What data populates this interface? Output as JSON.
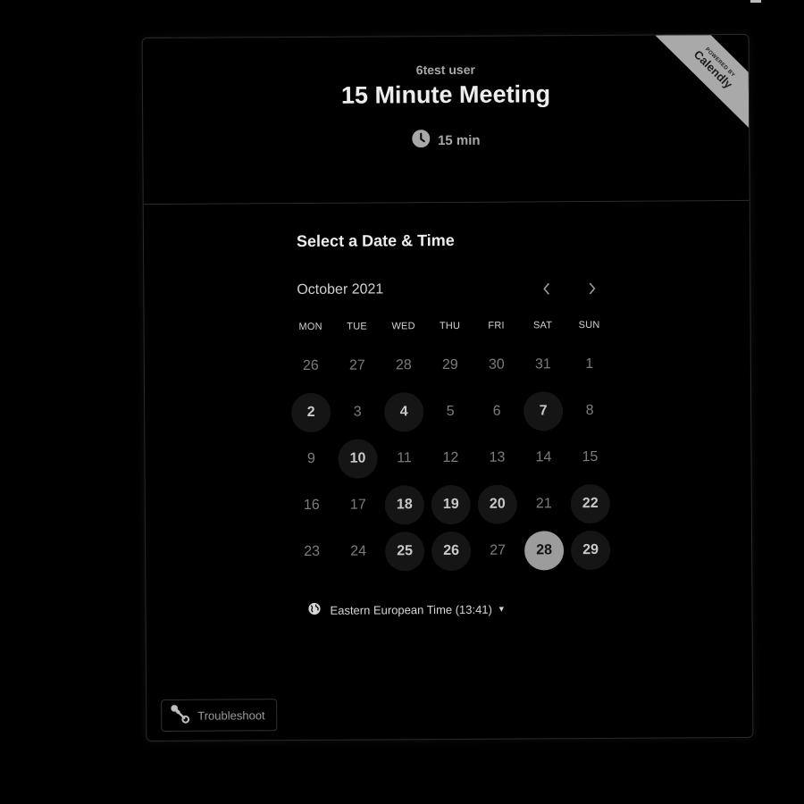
{
  "ribbon": {
    "powered_by": "POWERED BY",
    "brand": "Calendly"
  },
  "header": {
    "host_name": "6test user",
    "event_title": "15 Minute Meeting",
    "duration": "15 min",
    "duration_icon": "clock-icon"
  },
  "scheduler": {
    "section_title": "Select a Date & Time",
    "month_label": "October 2021",
    "prev_icon": "chevron-left-icon",
    "next_icon": "chevron-right-icon",
    "weekdays": [
      "MON",
      "TUE",
      "WED",
      "THU",
      "FRI",
      "SAT",
      "SUN"
    ],
    "days": [
      {
        "label": "26",
        "state": "other"
      },
      {
        "label": "27",
        "state": "other"
      },
      {
        "label": "28",
        "state": "other"
      },
      {
        "label": "29",
        "state": "other"
      },
      {
        "label": "30",
        "state": "other"
      },
      {
        "label": "31",
        "state": "other"
      },
      {
        "label": "1",
        "state": "unavailable"
      },
      {
        "label": "2",
        "state": "available"
      },
      {
        "label": "3",
        "state": "unavailable"
      },
      {
        "label": "4",
        "state": "available"
      },
      {
        "label": "5",
        "state": "unavailable"
      },
      {
        "label": "6",
        "state": "unavailable"
      },
      {
        "label": "7",
        "state": "available"
      },
      {
        "label": "8",
        "state": "unavailable"
      },
      {
        "label": "9",
        "state": "unavailable"
      },
      {
        "label": "10",
        "state": "available"
      },
      {
        "label": "11",
        "state": "unavailable"
      },
      {
        "label": "12",
        "state": "unavailable"
      },
      {
        "label": "13",
        "state": "unavailable"
      },
      {
        "label": "14",
        "state": "unavailable"
      },
      {
        "label": "15",
        "state": "unavailable"
      },
      {
        "label": "16",
        "state": "unavailable"
      },
      {
        "label": "17",
        "state": "unavailable"
      },
      {
        "label": "18",
        "state": "available"
      },
      {
        "label": "19",
        "state": "available"
      },
      {
        "label": "20",
        "state": "available"
      },
      {
        "label": "21",
        "state": "unavailable"
      },
      {
        "label": "22",
        "state": "available"
      },
      {
        "label": "23",
        "state": "unavailable"
      },
      {
        "label": "24",
        "state": "unavailable"
      },
      {
        "label": "25",
        "state": "available"
      },
      {
        "label": "26",
        "state": "available"
      },
      {
        "label": "27",
        "state": "unavailable"
      },
      {
        "label": "28",
        "state": "selected"
      },
      {
        "label": "29",
        "state": "available"
      }
    ],
    "timezone_label": "Eastern European Time (13:41)",
    "timezone_icon": "globe-icon",
    "timezone_caret_icon": "caret-down-icon"
  },
  "footer": {
    "troubleshoot_label": "Troubleshoot",
    "troubleshoot_icon": "wrench-icon"
  },
  "colors": {
    "background": "#000000",
    "available_day_bg": "#151515",
    "selected_day_bg": "#9c9c9c",
    "ribbon_bg": "#a9a9a9"
  }
}
